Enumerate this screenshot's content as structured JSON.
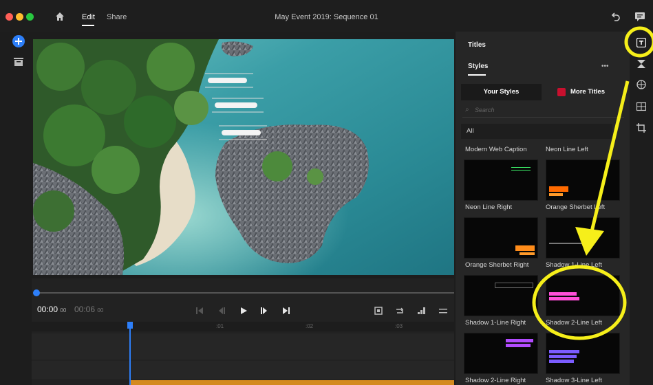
{
  "window": {
    "title": "May Event 2019: Sequence 01",
    "tabs": [
      "Edit",
      "Share"
    ],
    "traffic_colors": [
      "#ff5f57",
      "#febc2e",
      "#28c840"
    ]
  },
  "playback": {
    "current_time": "00:00",
    "current_frames": "00",
    "duration": "00:06",
    "duration_frames": "00"
  },
  "ruler": {
    "marks": [
      ":01",
      ":02",
      ":03"
    ]
  },
  "panel": {
    "section_title": "Titles",
    "styles_tab": "Styles",
    "more_label": "•••",
    "your_styles": "Your Styles",
    "more_titles": "More Titles",
    "search_placeholder": "Search",
    "filter": "All",
    "titles": [
      "Modern Web Caption",
      "Neon Line Left",
      "Neon Line Right",
      "Orange Sherbet Left",
      "Orange Sherbet Right",
      "Shadow 1-Line Left",
      "Shadow 1-Line Right",
      "Shadow 2-Line Left",
      "Shadow 2-Line Right",
      "Shadow 3-Line Left"
    ]
  },
  "colors": {
    "accent_blue": "#2d7ff9",
    "annotation_yellow": "#f6ef1a",
    "more_titles_badge": "#c8102e"
  },
  "icons": {
    "home": "home-icon",
    "undo": "undo-icon",
    "feedback": "feedback-icon",
    "add_media": "add-media-icon",
    "library": "library-icon",
    "titles": "titles-icon",
    "transitions": "transitions-icon",
    "effects": "effects-icon",
    "layout": "layout-icon",
    "crop": "crop-icon"
  }
}
